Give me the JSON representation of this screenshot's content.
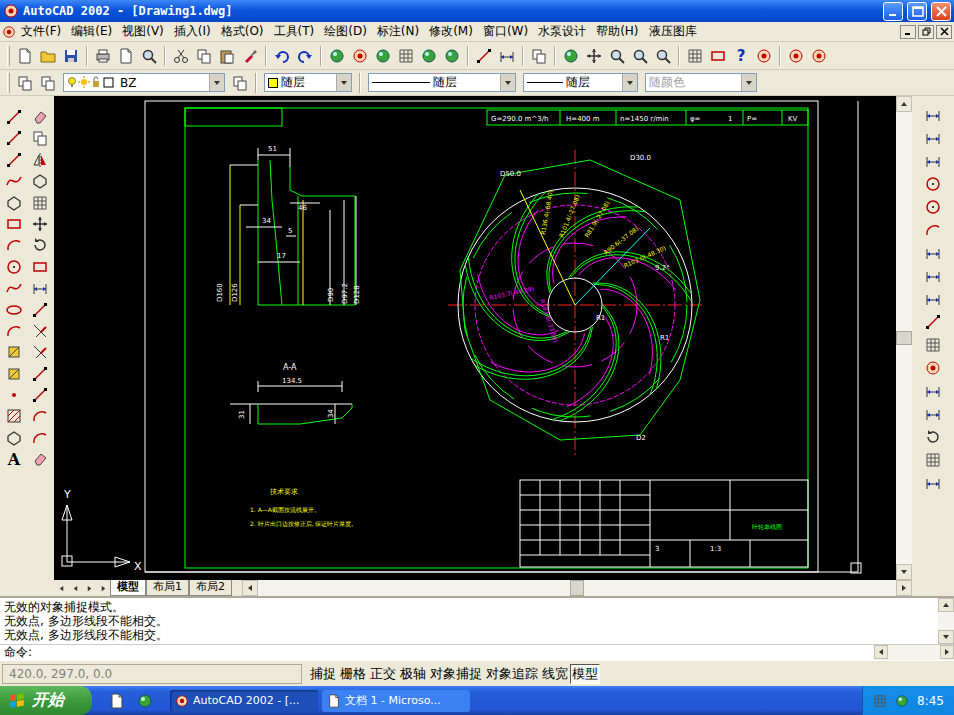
{
  "window": {
    "title": "AutoCAD 2002 - [Drawing1.dwg]"
  },
  "menu": [
    "文件(F)",
    "编辑(E)",
    "视图(V)",
    "插入(I)",
    "格式(O)",
    "工具(T)",
    "绘图(D)",
    "标注(N)",
    "修改(M)",
    "窗口(W)",
    "水泵设计",
    "帮助(H)",
    "液压图库"
  ],
  "toolbar": {
    "help": "?"
  },
  "properties_bar": {
    "layer": "BZ",
    "color": "随层",
    "linetype": "随层",
    "lineweight": "随层",
    "plotstyle": "随颜色",
    "plotstyle_disabled": true
  },
  "draw_toolbar": {
    "text_tool": "A"
  },
  "drawing": {
    "spec": [
      "G=290.0 m^3/h",
      "H=400 m",
      "n=1450 r/min",
      "φ=",
      "1",
      "P=",
      "KV"
    ],
    "section_dims": [
      "51",
      "46",
      "34",
      "5",
      "17",
      "D160",
      "D126",
      "D90",
      "D97.2",
      "D128"
    ],
    "section_title": "A-A",
    "aa_dims": [
      "134.5",
      "31",
      "34"
    ],
    "impeller_labels": [
      "D50.0",
      "D30.0",
      "9.2°",
      "R1",
      "R1",
      "D2"
    ],
    "radial_labels": [
      "R136.4(-68.40)",
      "R101.4(-27.08)",
      "R81.9(-27.08)",
      "R90.6(-37.08)",
      "R103.0(-48.30)",
      "R103.7(-44.29)",
      "R133.6(-33.58)"
    ],
    "notes_title": "技术要求",
    "notes": [
      "1. A—A截面按流线展开。",
      "2. 叶片出口边按修正后, 保证叶片厚度。"
    ],
    "title_block": {
      "name": "叶轮单线图",
      "count": "3",
      "scale": "1:3"
    },
    "axes": [
      "Y",
      "X"
    ]
  },
  "layout_tabs": [
    {
      "label": "模型",
      "selected": true
    },
    {
      "label": "布局1",
      "selected": false
    },
    {
      "label": "布局2",
      "selected": false
    }
  ],
  "command_lines": [
    "无效的对象捕捉模式。",
    "无效点, 多边形线段不能相交。",
    "无效点, 多边形线段不能相交。"
  ],
  "command_prompt": "命令:",
  "status_bar": {
    "coords": "420.0, 297.0, 0.0",
    "buttons": [
      {
        "label": "捕捉",
        "on": false
      },
      {
        "label": "栅格",
        "on": false
      },
      {
        "label": "正交",
        "on": false
      },
      {
        "label": "极轴",
        "on": false
      },
      {
        "label": "对象捕捉",
        "on": false
      },
      {
        "label": "对象追踪",
        "on": false
      },
      {
        "label": "线宽",
        "on": false
      },
      {
        "label": "模型",
        "on": true
      }
    ]
  },
  "taskbar": {
    "start": "开始",
    "tasks": [
      {
        "label": "AutoCAD 2002 - [...",
        "selected": true
      },
      {
        "label": "文档 1 - Microso...",
        "selected": false
      }
    ],
    "clock": "8:45"
  }
}
